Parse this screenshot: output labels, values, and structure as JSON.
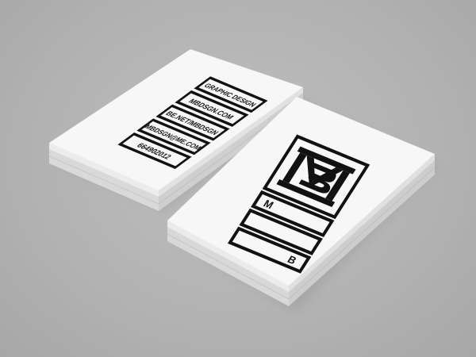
{
  "scene": {
    "background": "#b5b5b5",
    "card_face": "#f7f7f7",
    "card_edge": "#e4e4e4",
    "ink": "#111111"
  },
  "left_card": {
    "lines": [
      "GRAPHIC DESIGN",
      "MBDSGN.COM",
      "BE.NET/MBDSGN",
      "MBDSGN@ME.COM",
      "664902012"
    ]
  },
  "right_card": {
    "monogram": "MB",
    "letter_m": "M",
    "letter_b": "B"
  }
}
